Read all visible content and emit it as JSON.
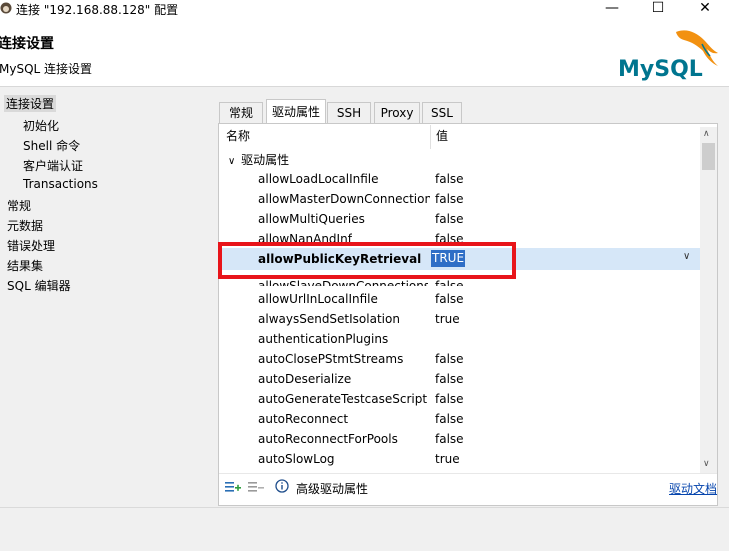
{
  "window": {
    "title": "连接 \"192.168.88.128\" 配置",
    "minimize": "—",
    "maximize": "☐",
    "close": "✕"
  },
  "header": {
    "title": "连接设置",
    "subtitle": "MySQL 连接设置",
    "logo_text": "MySQL"
  },
  "sidebar": {
    "items": [
      {
        "label": "连接设置",
        "selected": true
      },
      {
        "label": "初始化"
      },
      {
        "label": "Shell 命令"
      },
      {
        "label": "客户端认证"
      },
      {
        "label": "Transactions"
      },
      {
        "label": "常规"
      },
      {
        "label": "元数据"
      },
      {
        "label": "错误处理"
      },
      {
        "label": "结果集"
      },
      {
        "label": "SQL 编辑器"
      }
    ]
  },
  "tabs": [
    {
      "label": "常规"
    },
    {
      "label": "驱动属性",
      "active": true
    },
    {
      "label": "SSH"
    },
    {
      "label": "Proxy"
    },
    {
      "label": "SSL"
    }
  ],
  "table": {
    "col_name": "名称",
    "col_value": "值",
    "group_label": "驱动属性",
    "rows": [
      {
        "name": "allowLoadLocalInfile",
        "value": "false"
      },
      {
        "name": "allowMasterDownConnections",
        "value": "false"
      },
      {
        "name": "allowMultiQueries",
        "value": "false"
      },
      {
        "name": "allowNanAndInf",
        "value": "false"
      },
      {
        "name": "allowPublicKeyRetrieval",
        "value": "TRUE",
        "selected": true
      },
      {
        "name": "allowSlaveDownConnections",
        "value": "false"
      },
      {
        "name": "allowUrlInLocalInfile",
        "value": "false"
      },
      {
        "name": "alwaysSendSetIsolation",
        "value": "true"
      },
      {
        "name": "authenticationPlugins",
        "value": ""
      },
      {
        "name": "autoClosePStmtStreams",
        "value": "false"
      },
      {
        "name": "autoDeserialize",
        "value": "false"
      },
      {
        "name": "autoGenerateTestcaseScript",
        "value": "false"
      },
      {
        "name": "autoReconnect",
        "value": "false"
      },
      {
        "name": "autoReconnectForPools",
        "value": "false"
      },
      {
        "name": "autoSlowLog",
        "value": "true"
      }
    ]
  },
  "bottom": {
    "advanced_label": "高级驱动属性",
    "doc_link": "驱动文档"
  },
  "colors": {
    "selection": "#2f6ec6",
    "row_highlight": "#d6e7f8",
    "annotation": "#e8141a",
    "link": "#0645ad",
    "mysql_blue": "#00758f",
    "mysql_orange": "#f29111"
  }
}
